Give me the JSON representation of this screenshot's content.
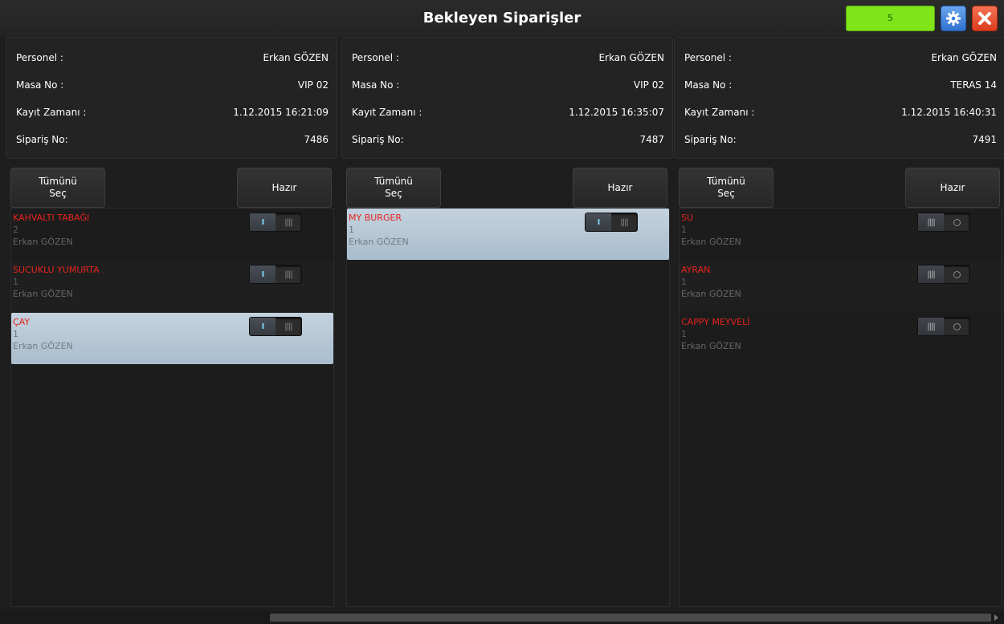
{
  "header": {
    "title": "Bekleyen Siparişler",
    "counter": "5",
    "settings_icon": "gear-icon",
    "close_icon": "close-icon"
  },
  "columns": [
    {
      "info": {
        "staff_label": "Personel :",
        "staff_value": "Erkan GÖZEN",
        "table_label": "Masa No :",
        "table_value": "VIP 02",
        "time_label": "Kayıt Zamanı :",
        "time_value": "1.12.2015 16:21:09",
        "order_label": "Sipariş No:",
        "order_value": "7486"
      },
      "select_all_line1": "Tümünü",
      "select_all_line2": "Seç",
      "ready_label": "Hazır",
      "items": [
        {
          "name": "KAHVALTI TABAĞI",
          "qty": "2",
          "user": "Erkan GÖZEN",
          "toggle": "on"
        },
        {
          "name": "SUCUKLU YUMURTA",
          "qty": "1",
          "user": "Erkan GÖZEN",
          "toggle": "on"
        },
        {
          "name": "ÇAY",
          "qty": "1",
          "user": "Erkan GÖZEN",
          "toggle": "on",
          "selected": true
        }
      ]
    },
    {
      "info": {
        "staff_label": "Personel :",
        "staff_value": "Erkan GÖZEN",
        "table_label": "Masa No :",
        "table_value": "VIP 02",
        "time_label": "Kayıt Zamanı :",
        "time_value": "1.12.2015 16:35:07",
        "order_label": "Sipariş No:",
        "order_value": "7487"
      },
      "select_all_line1": "Tümünü",
      "select_all_line2": "Seç",
      "ready_label": "Hazır",
      "items": [
        {
          "name": "MY BURGER",
          "qty": "1",
          "user": "Erkan GÖZEN",
          "toggle": "on",
          "selected": true
        }
      ]
    },
    {
      "info": {
        "staff_label": "Personel :",
        "staff_value": "Erkan GÖZEN",
        "table_label": "Masa No :",
        "table_value": "TERAS 14",
        "time_label": "Kayıt Zamanı :",
        "time_value": "1.12.2015 16:40:31",
        "order_label": "Sipariş No:",
        "order_value": "7491"
      },
      "select_all_line1": "Tümünü",
      "select_all_line2": "Seç",
      "ready_label": "Hazır",
      "items": [
        {
          "name": "SU",
          "qty": "1",
          "user": "Erkan GÖZEN",
          "toggle": "off"
        },
        {
          "name": "AYRAN",
          "qty": "1",
          "user": "Erkan GÖZEN",
          "toggle": "off"
        },
        {
          "name": "CAPPY MEYVELİ",
          "qty": "1",
          "user": "Erkan GÖZEN",
          "toggle": "off"
        }
      ]
    }
  ],
  "colors": {
    "counter_bg": "#7fe41a",
    "item_name": "#e7231e",
    "selected_row": "#b7c8d6"
  }
}
